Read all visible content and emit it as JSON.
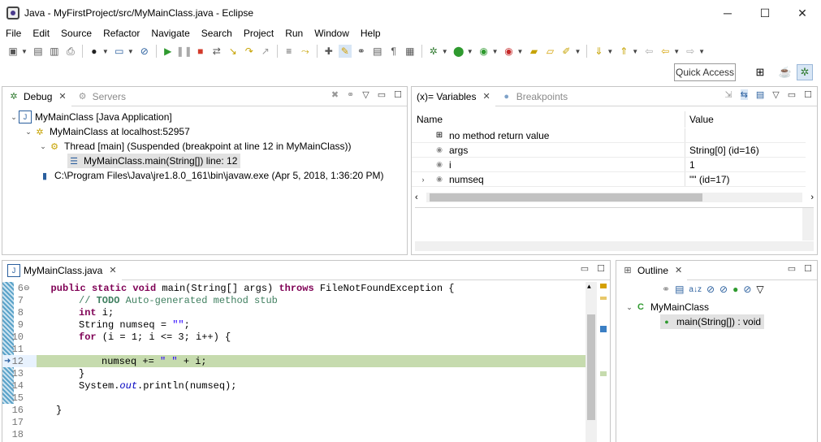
{
  "window": {
    "title": "Java - MyFirstProject/src/MyMainClass.java - Eclipse",
    "minimize": "─",
    "maximize": "☐",
    "close": "✕"
  },
  "menu": [
    "File",
    "Edit",
    "Source",
    "Refactor",
    "Navigate",
    "Search",
    "Project",
    "Run",
    "Window",
    "Help"
  ],
  "quick_access": "Quick Access",
  "debug_view": {
    "tab_active": "Debug",
    "tab_inactive": "Servers",
    "tree": [
      {
        "label": "MyMainClass [Java Application]"
      },
      {
        "label": "MyMainClass at localhost:52957"
      },
      {
        "label": "Thread [main] (Suspended (breakpoint at line 12 in MyMainClass))"
      },
      {
        "label": "MyMainClass.main(String[]) line: 12"
      },
      {
        "label": "C:\\Program Files\\Java\\jre1.8.0_161\\bin\\javaw.exe (Apr 5, 2018, 1:36:20 PM)"
      }
    ]
  },
  "variables_view": {
    "tab_active": "(x)= Variables",
    "tab_inactive": "Breakpoints",
    "col_name": "Name",
    "col_value": "Value",
    "rows": [
      {
        "name": "no method return value",
        "value": ""
      },
      {
        "name": "args",
        "value": "String[0]  (id=16)"
      },
      {
        "name": "i",
        "value": "1"
      },
      {
        "name": "numseq",
        "value": "\"\" (id=17)"
      }
    ]
  },
  "editor": {
    "tab": "MyMainClass.java",
    "line_numbers": [
      "6",
      "7",
      "8",
      "9",
      "10",
      "11",
      "12",
      "13",
      "14",
      "15",
      "16",
      "17",
      "18"
    ]
  },
  "outline_view": {
    "tab": "Outline",
    "class_name": "MyMainClass",
    "method": "main(String[]) : void"
  }
}
